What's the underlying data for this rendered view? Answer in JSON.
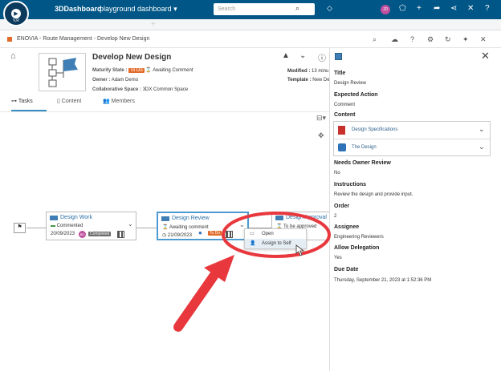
{
  "topbar": {
    "logo_version": "V,R",
    "app_title": "3DDashboard",
    "dashboard_name": "playground dashboard",
    "search_placeholder": "Search",
    "avatar_initials": "JD"
  },
  "panel": {
    "breadcrumb": "ENOVIA - Route Management - Develop New Design"
  },
  "object": {
    "title": "Develop New Design",
    "maturity_label": "Maturity State :",
    "maturity_badge": "To Do",
    "maturity_status": "Awaiting Comment",
    "owner_label": "Owner :",
    "owner_value": "Adam Demo",
    "collab_label": "Collaborative Space :",
    "collab_value": "3DX Common Space",
    "modified_label": "Modified :",
    "modified_value": "13 minu",
    "template_label": "Template :",
    "template_value": "New De"
  },
  "tabs": [
    {
      "label": "Tasks"
    },
    {
      "label": "Content"
    },
    {
      "label": "Members"
    }
  ],
  "tasks": [
    {
      "title": "Design Work",
      "status": "Commented",
      "date": "20/09/2023",
      "initials": "BD",
      "badge": "Completed"
    },
    {
      "title": "Design Review",
      "status": "Awaiting comment",
      "date": "21/09/2023",
      "badge": "To Do"
    },
    {
      "title": "Design Approval",
      "status": "To be approved"
    }
  ],
  "context_menu": {
    "items": [
      {
        "label": "Open"
      },
      {
        "label": "Assign to Self"
      }
    ]
  },
  "details": {
    "title_label": "Title",
    "title_value": "Design Review",
    "expected_label": "Expected Action",
    "expected_value": "Comment",
    "content_label": "Content",
    "content_items": [
      {
        "name": "Design Specifications"
      },
      {
        "name": "The Design"
      }
    ],
    "needs_owner_label": "Needs Owner Review",
    "needs_owner_value": "No",
    "instructions_label": "Instructions",
    "instructions_value": "Review the design and provide input.",
    "order_label": "Order",
    "order_value": "2",
    "assignee_label": "Assignee",
    "assignee_value": "Engineering Reviewers",
    "allow_delegation_label": "Allow Delegation",
    "allow_delegation_value": "Yes",
    "due_date_label": "Due Date",
    "due_date_value": "Thursday, September 21, 2023 at 1:52:36 PM"
  },
  "colors": {
    "topbar": "#005686",
    "accent": "#368ec4",
    "todo": "#e36b2a",
    "completed": "#6b6b6b",
    "annotation": "#e8383d"
  },
  "icons": [
    "compass-icon",
    "search-icon",
    "tag-icon",
    "home-icon",
    "chevron-up-icon",
    "chevron-down-icon",
    "info-icon",
    "close-icon",
    "flag-icon",
    "cursor-icon",
    "arrow-annotation"
  ]
}
